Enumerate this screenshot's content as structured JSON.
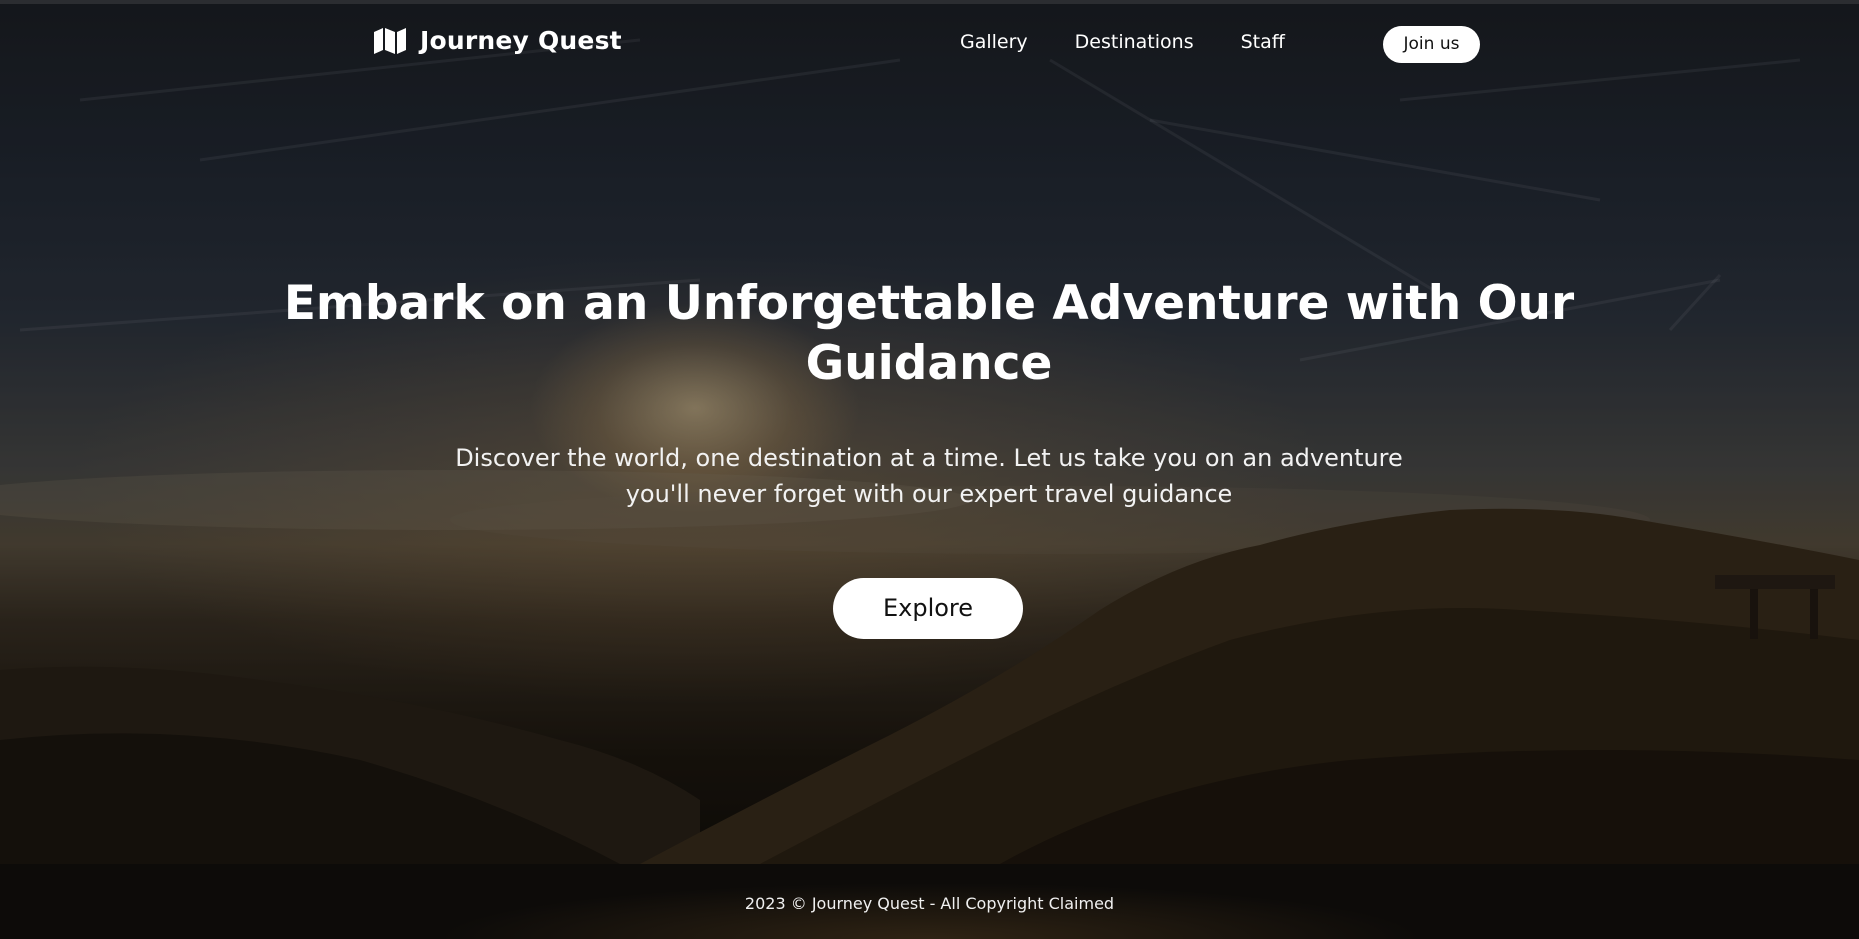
{
  "header": {
    "brand_name": "Journey Quest",
    "brand_icon": "map-icon",
    "nav_links": [
      "Gallery",
      "Destinations",
      "Staff"
    ],
    "cta_label": "Join us"
  },
  "hero": {
    "title": "Embark on an Unforgettable Adventure with Our Guidance",
    "subtitle": "Discover the world, one destination at a time. Let us take you on an adventure you'll never forget with our expert travel guidance",
    "button_label": "Explore"
  },
  "footer": {
    "text": "2023 © Journey Quest - All Copyright Claimed"
  },
  "colors": {
    "button_bg": "#ffffff",
    "button_text": "#111111",
    "text": "#ffffff",
    "footer_bg": "#0d0b09"
  }
}
